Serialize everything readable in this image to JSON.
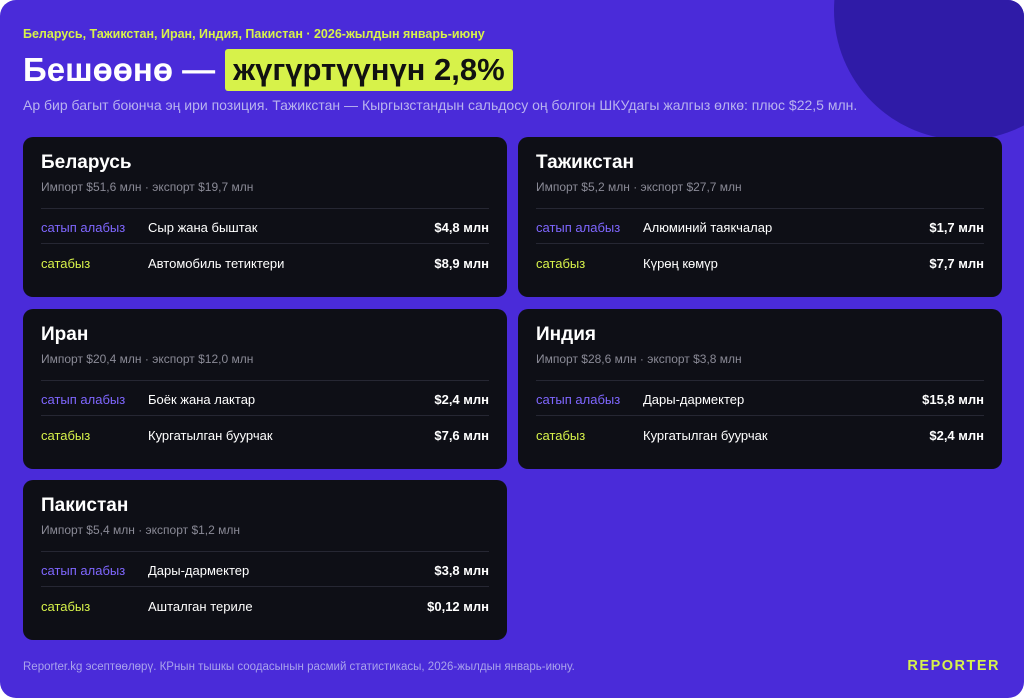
{
  "kicker": "Беларусь, Тажикстан, Иран, Индия, Пакистан · 2026-жылдын январь-июну",
  "title": {
    "main": "Бешөөнө —",
    "highlight": "жүгүртүүнүн 2,8%"
  },
  "subtitle": "Ар бир багыт боюнча эң ири позиция. Тажикстан — Кыргызстандын сальдосу оң болгон ШКУдагы жалгыз өлкө: плюс $22,5 млн.",
  "cards": [
    {
      "name": "Беларусь",
      "trade": "Импорт $51,6 млн · экспорт $19,7 млн",
      "rows": [
        {
          "role": "сатып алабыз",
          "product": "Сыр жана быштак",
          "value": "$4,8 млн"
        },
        {
          "role": "сатабыз",
          "product": "Автомобиль тетиктери",
          "value": "$8,9 млн"
        }
      ]
    },
    {
      "name": "Тажикстан",
      "trade": "Импорт $5,2 млн · экспорт $27,7 млн",
      "rows": [
        {
          "role": "сатып алабыз",
          "product": "Алюминий таякчалар",
          "value": "$1,7 млн"
        },
        {
          "role": "сатабыз",
          "product": "Күрөң көмүр",
          "value": "$7,7 млн"
        }
      ]
    },
    {
      "name": "Иран",
      "trade": "Импорт $20,4 млн · экспорт $12,0 млн",
      "rows": [
        {
          "role": "сатып алабыз",
          "product": "Боёк жана лактар",
          "value": "$2,4 млн"
        },
        {
          "role": "сатабыз",
          "product": "Кургатылган буурчак",
          "value": "$7,6 млн"
        }
      ]
    },
    {
      "name": "Индия",
      "trade": "Импорт $28,6 млн · экспорт $3,8 млн",
      "rows": [
        {
          "role": "сатып алабыз",
          "product": "Дары-дармектер",
          "value": "$15,8 млн"
        },
        {
          "role": "сатабыз",
          "product": "Кургатылган буурчак",
          "value": "$2,4 млн"
        }
      ]
    },
    {
      "name": "Пакистан",
      "trade": "Импорт $5,4 млн · экспорт $1,2 млн",
      "rows": [
        {
          "role": "сатып алабыз",
          "product": "Дары-дармектер",
          "value": "$3,8 млн"
        },
        {
          "role": "сатабыз",
          "product": "Ашталган териле",
          "value": "$0,12 млн"
        }
      ]
    }
  ],
  "footer": "Reporter.kg эсептөөлөрү. КРнын тышкы соодасынын расмий статистикасы, 2026-жылдын январь-июну.",
  "logo": "REPORTER",
  "colors": {
    "background": "#4a2bd9",
    "card": "#0e0f16",
    "accent_lime": "#d7f24a",
    "accent_violet": "#7f67ff"
  }
}
